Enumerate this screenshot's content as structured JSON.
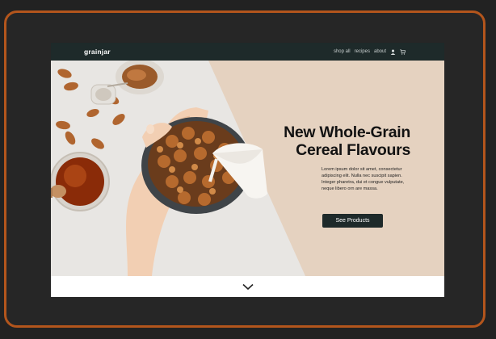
{
  "site": {
    "logo": "grainjar",
    "nav": [
      "shop all",
      "recipes",
      "about"
    ],
    "nav_icons": [
      "user-icon",
      "cart-icon"
    ]
  },
  "hero": {
    "headline_line1": "New Whole-Grain",
    "headline_line2": "Cereal Flavours",
    "body": "Lorem ipsum dolor sit amet, consectetur adipiscing elit. Nulla nec suscipit sapien. Integer pharetra, dui et congue vulputate, neque libero orn are massa.",
    "cta_label": "See Products"
  },
  "scroll": {
    "icon": "chevron-down-icon"
  },
  "colors": {
    "frame_border": "#b3551c",
    "navbar": "#1e2a2a",
    "hero_bg": "#e5d2c0",
    "button": "#1e2a2a"
  }
}
